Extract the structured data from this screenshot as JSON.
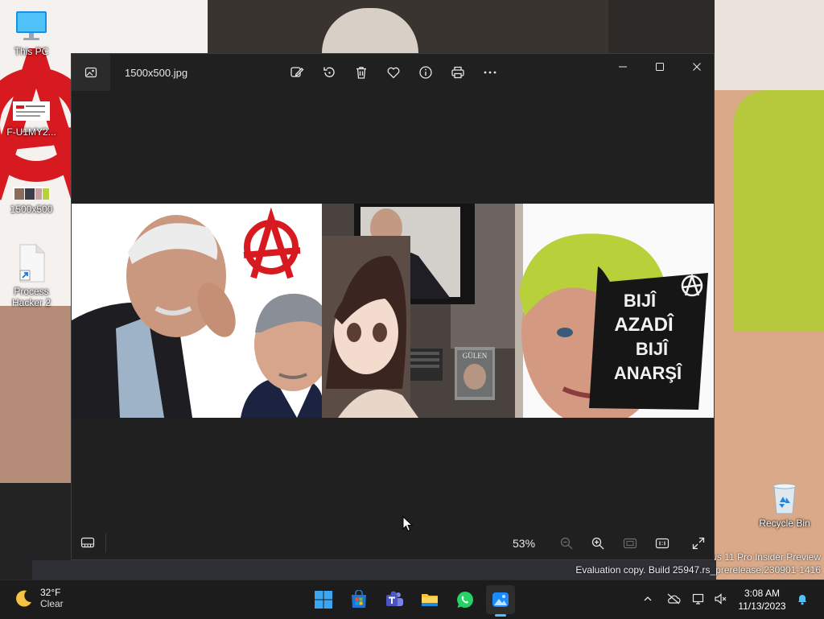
{
  "desktop": {
    "icons": [
      {
        "label": "This PC",
        "icon": "computer-icon"
      },
      {
        "label": "F-U1MY2...",
        "icon": "document-thumbnail-icon"
      },
      {
        "label": "1500x500",
        "icon": "image-thumbnail-icon"
      },
      {
        "label": "Process Hacker 2",
        "icon": "shortcut-file-icon"
      },
      {
        "label": "Recycle Bin",
        "icon": "recycle-bin-icon"
      }
    ],
    "watermark": {
      "line1": "ws 11 Pro Insider Preview",
      "line2": "Evaluation copy. Build 25947.rs_prerelease.230901-1416"
    }
  },
  "photos": {
    "file_name": "1500x500.jpg",
    "toolbar": [
      "edit-image-icon",
      "rotate-icon",
      "delete-icon",
      "favorite-heart-icon",
      "file-info-icon",
      "print-icon",
      "more-options-icon"
    ],
    "window_controls": [
      "minimize-icon",
      "maximize-icon",
      "close-icon"
    ],
    "image_text": {
      "sign": [
        "BIJÎ",
        "AZADÎ",
        "BIJÎ",
        "ANARŞÎ"
      ],
      "book_title": "GÜLEN"
    },
    "status": {
      "zoom": "53%"
    }
  },
  "taskbar": {
    "weather": {
      "temp": "32°F",
      "condition": "Clear"
    },
    "apps": [
      "windows-start-icon",
      "microsoft-store-icon",
      "teams-icon",
      "file-explorer-icon",
      "whatsapp-icon",
      "photos-app-icon"
    ],
    "active_app": "photos-app-icon",
    "clock": {
      "time": "3:08 AM",
      "date": "11/13/2023"
    }
  },
  "colors": {
    "window_bg": "#202020",
    "taskbar_bg": "#1c1c1c",
    "accent": "#4cc2ff",
    "anarchy_red": "#d71920",
    "hair_green": "#b8d13a"
  }
}
